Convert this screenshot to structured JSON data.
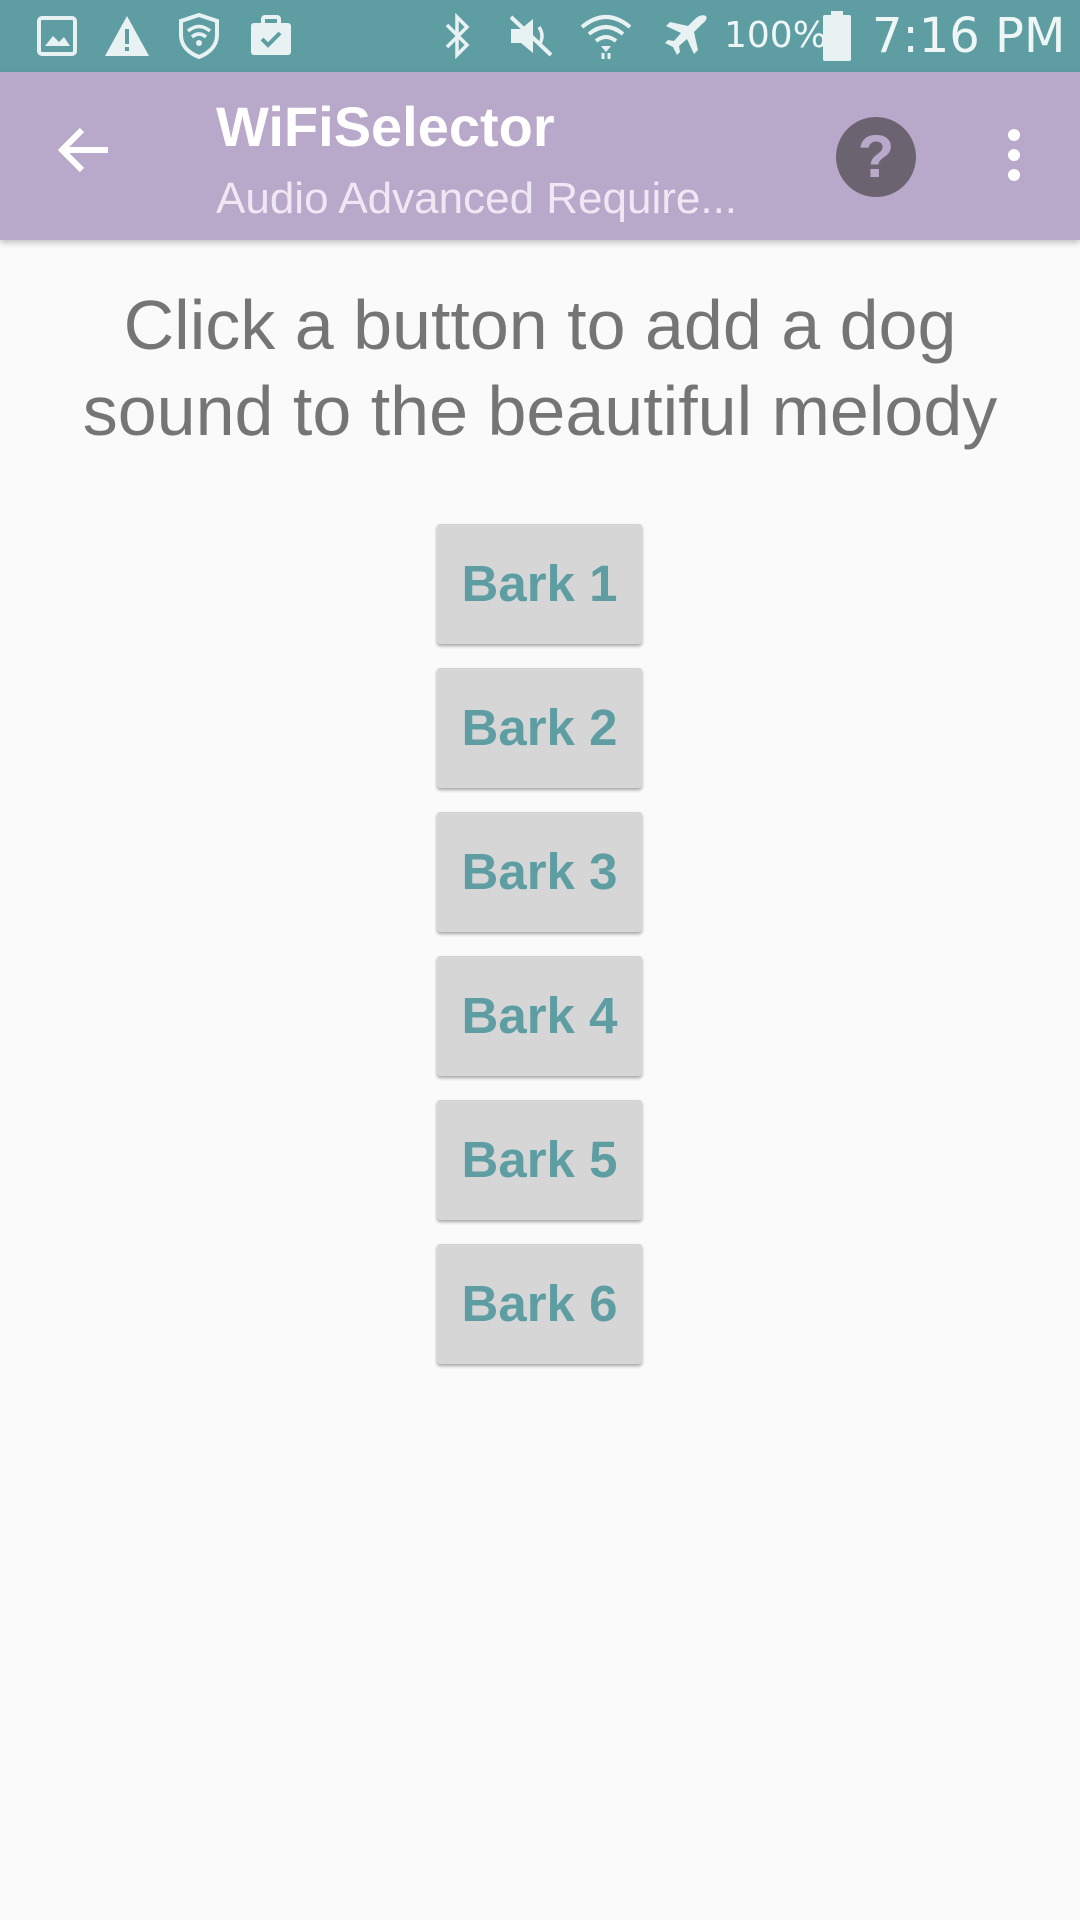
{
  "status_bar": {
    "icons": [
      "gallery-icon",
      "warning-icon",
      "shield-wifi-icon",
      "clipboard-check-icon",
      "bluetooth-icon",
      "mute-icon",
      "wifi-icon",
      "airplane-icon",
      "battery-icon"
    ],
    "battery_percent": "100%",
    "time": "7:16 PM"
  },
  "app_bar": {
    "title": "WiFiSelector",
    "subtitle": "Audio Advanced Require...",
    "help_label": "?",
    "colors": {
      "background": "#b8a8c9",
      "status_bar": "#5e9ea3"
    }
  },
  "main": {
    "instruction": "Click a button to add a dog sound to the beautiful melody",
    "buttons": [
      {
        "label": "Bark 1"
      },
      {
        "label": "Bark 2"
      },
      {
        "label": "Bark 3"
      },
      {
        "label": "Bark 4"
      },
      {
        "label": "Bark 5"
      },
      {
        "label": "Bark 6"
      }
    ],
    "accent_color": "#5e9ea3"
  }
}
